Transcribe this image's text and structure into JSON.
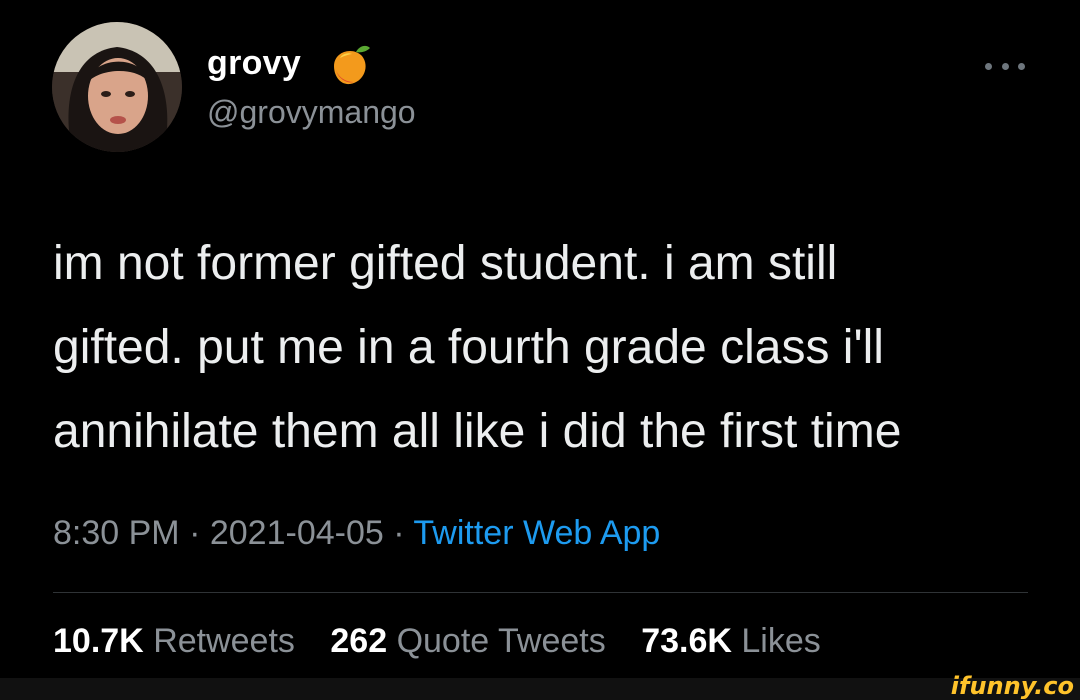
{
  "tweet": {
    "display_name": "grovy",
    "handle": "@grovymango",
    "name_emoji": "mango-emoji",
    "text_lines": [
      "im not former gifted student. i am still",
      "gifted. put me in a fourth grade class i'll",
      "annihilate them all like i did the first time"
    ],
    "time": "8:30 PM",
    "date": "2021-04-05",
    "separator": "·",
    "source": "Twitter Web App",
    "stats": {
      "retweets_count": "10.7K",
      "retweets_label": "Retweets",
      "quotes_count": "262",
      "quotes_label": "Quote Tweets",
      "likes_count": "73.6K",
      "likes_label": "Likes"
    }
  },
  "watermark": "ifunny.co",
  "colors": {
    "background": "#000000",
    "text": "#e7e9ea",
    "secondary": "#8b9197",
    "link": "#1d9bf0",
    "watermark": "#ffc32b"
  },
  "icons": [
    "avatar",
    "mango-emoji",
    "more-icon"
  ]
}
